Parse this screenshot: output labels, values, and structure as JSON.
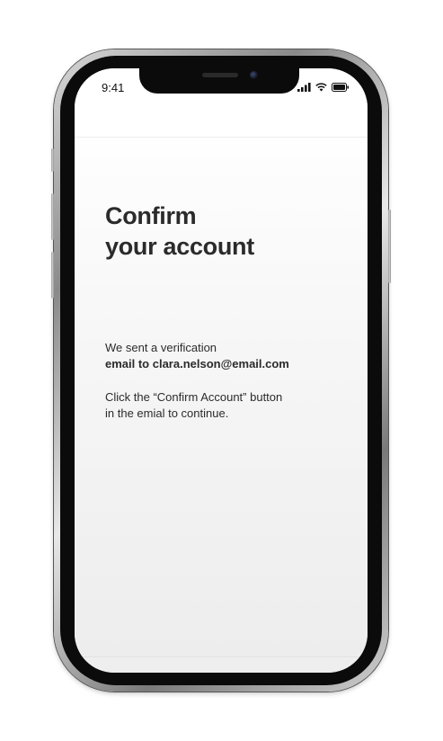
{
  "status_bar": {
    "time": "9:41",
    "icons": [
      "signal-icon",
      "wifi-icon",
      "battery-icon"
    ]
  },
  "screen": {
    "title_line1": "Confirm",
    "title_line2": "your account",
    "message_line1": "We sent a verification",
    "message_line2": "email to clara.nelson@email.com",
    "instruction_line1": "Click the “Confirm Account” button",
    "instruction_line2": "in the emial to continue."
  },
  "colors": {
    "text": "#2b2b2b",
    "frame": "#0b0b0b"
  }
}
